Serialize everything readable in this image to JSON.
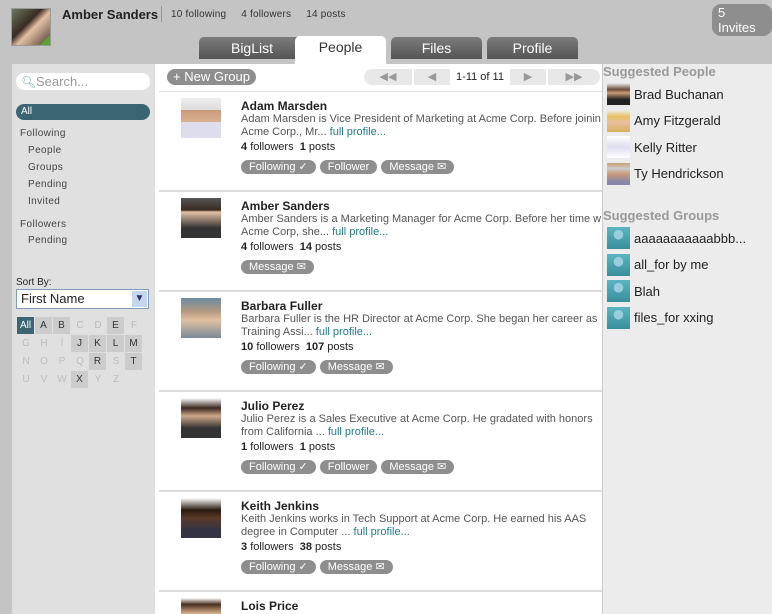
{
  "user": {
    "name": "Amber Sanders",
    "following": "10",
    "following_label": "following",
    "followers": "4",
    "followers_label": "followers",
    "posts": "14",
    "posts_label": "posts"
  },
  "invites": "5 Invites",
  "tabs": [
    "BigList",
    "People",
    "Files",
    "Profile"
  ],
  "search": {
    "placeholder": "Search..."
  },
  "nav": {
    "all": "All",
    "following": "Following",
    "following_items": [
      "People",
      "Groups",
      "Pending",
      "Invited"
    ],
    "followers": "Followers",
    "followers_items": [
      "Pending"
    ]
  },
  "sort": {
    "label": "Sort By:",
    "value": "First Name"
  },
  "letters": [
    "All",
    "A",
    "B",
    "C",
    "D",
    "E",
    "F",
    "G",
    "H",
    "I",
    "J",
    "K",
    "L",
    "M",
    "N",
    "O",
    "P",
    "Q",
    "R",
    "S",
    "T",
    "U",
    "V",
    "W",
    "X",
    "Y",
    "Z"
  ],
  "letters_active": [
    "All",
    "A",
    "B",
    "E",
    "J",
    "K",
    "L",
    "M",
    "R",
    "T",
    "X"
  ],
  "new_group": "New Group",
  "pager": {
    "first": "◀◀",
    "prev": "◀",
    "info": "1-11 of 11",
    "next": "▶",
    "last": "▶▶"
  },
  "full_profile": "full profile...",
  "people": [
    {
      "name": "Adam Marsden",
      "bio": "Adam Marsden is Vice President of Marketing at Acme Corp. Before joining",
      "bio2": "Acme Corp., Mr...",
      "followers": "4",
      "posts": "1",
      "buttons": [
        "Following ✓",
        "Follower",
        "Message ✉"
      ]
    },
    {
      "name": "Amber Sanders",
      "bio": "Amber Sanders is a Marketing Manager for Acme Corp. Before her time with",
      "bio2": "Acme Corp, she...",
      "followers": "4",
      "posts": "14",
      "buttons": [
        "Message ✉"
      ]
    },
    {
      "name": "Barbara Fuller",
      "bio": "Barbara Fuller is the HR Director at Acme Corp. She began her career as a",
      "bio2": "Training Assi...",
      "followers": "10",
      "posts": "107",
      "buttons": [
        "Following ✓",
        "Message ✉"
      ]
    },
    {
      "name": "Julio Perez",
      "bio": "Julio Perez is a Sales Executive at Acme Corp. He gradated with honors",
      "bio2": "from California ...",
      "followers": "1",
      "posts": "1",
      "buttons": [
        "Following ✓",
        "Follower",
        "Message ✉"
      ]
    },
    {
      "name": "Keith Jenkins",
      "bio": "Keith Jenkins works in Tech Support at Acme Corp. He earned his AAS",
      "bio2": "degree in Computer ...",
      "followers": "3",
      "posts": "38",
      "buttons": [
        "Following ✓",
        "Message ✉"
      ]
    },
    {
      "name": "Lois Price"
    }
  ],
  "followers_word": "followers",
  "posts_word": "posts",
  "suggested_people": {
    "title": "Suggested People",
    "items": [
      "Brad Buchanan",
      "Amy Fitzgerald",
      "Kelly Ritter",
      "Ty Hendrickson"
    ]
  },
  "suggested_groups": {
    "title": "Suggested Groups",
    "items": [
      "aaaaaaaaaaabbb...",
      "all_for by me",
      "Blah",
      "files_for xxing"
    ]
  }
}
